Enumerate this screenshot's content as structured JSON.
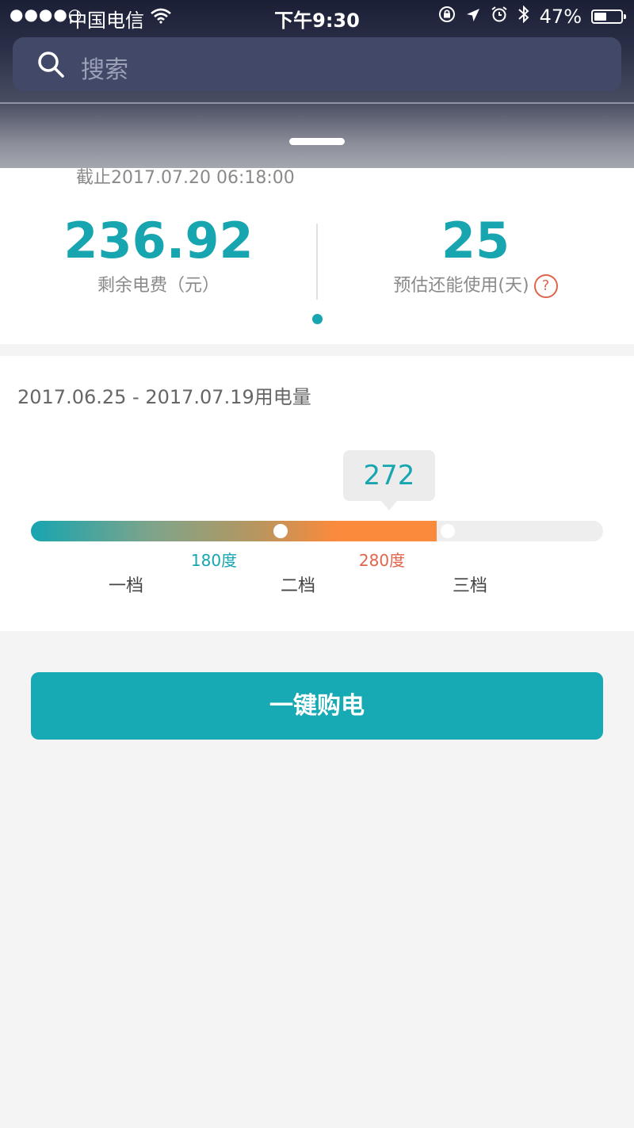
{
  "status_bar": {
    "signal": "●●●●○",
    "carrier": "中国电信",
    "time": "下午9:30",
    "battery_text": "47%",
    "battery_level": 0.47
  },
  "search": {
    "placeholder": "搜索"
  },
  "summary": {
    "as_of": "截止2017.07.20 06:18:00",
    "balance_value": "236.92",
    "balance_label": "剩余电费（元）",
    "days_value": "25",
    "days_label": "预估还能使用(天)",
    "help_glyph": "?"
  },
  "usage": {
    "title": "2017.06.25 - 2017.07.19用电量",
    "current_value": "272",
    "current_numeric": 272,
    "scale_max": 412,
    "threshold_1": {
      "label": "180度",
      "value": 180,
      "color": "#17a5b0"
    },
    "threshold_2": {
      "label": "280度",
      "value": 280,
      "color": "#e0644c"
    },
    "tiers": [
      "一档",
      "二档",
      "三档"
    ]
  },
  "buy_button": {
    "label": "一键购电"
  },
  "colors": {
    "accent": "#17a5b0",
    "warning": "#fb8a3c",
    "alert": "#e0644c"
  }
}
